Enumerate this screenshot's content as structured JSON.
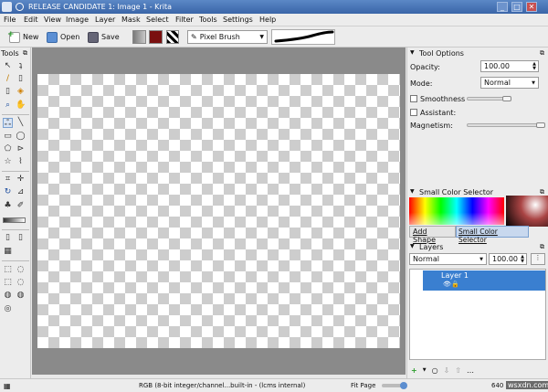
{
  "window": {
    "title": "RELEASE CANDIDATE 1: Image 1 - Krita",
    "min": "_",
    "max": "□",
    "close": "✕"
  },
  "menu": [
    "File",
    "Edit",
    "View",
    "Image",
    "Layer",
    "Mask",
    "Select",
    "Filter",
    "Tools",
    "Settings",
    "Help"
  ],
  "toolbar": {
    "new_label": "New",
    "open_label": "Open",
    "save_label": "Save",
    "brush_preset": "Pixel Brush"
  },
  "tools": {
    "title": "Tools"
  },
  "tool_options": {
    "title": "Tool Options",
    "opacity_label": "Opacity:",
    "opacity_value": "100.00",
    "mode_label": "Mode:",
    "mode_value": "Normal",
    "smoothness_label": "Smoothness",
    "assistant_label": "Assistant:",
    "magnetism_label": "Magnetism:"
  },
  "color_selector": {
    "title": "Small Color Selector",
    "tabs": [
      "Add Shape",
      "Small Color Selector"
    ]
  },
  "layers": {
    "title": "Layers",
    "blend_mode": "Normal",
    "opacity": "100.00",
    "items": [
      "Layer 1"
    ]
  },
  "statusbar": {
    "color_info": "RGB (8-bit integer/channel...built-in - (lcms internal)",
    "zoom": "Fit Page",
    "size": "640 x 4",
    "watermark": "wsxdn.com"
  }
}
